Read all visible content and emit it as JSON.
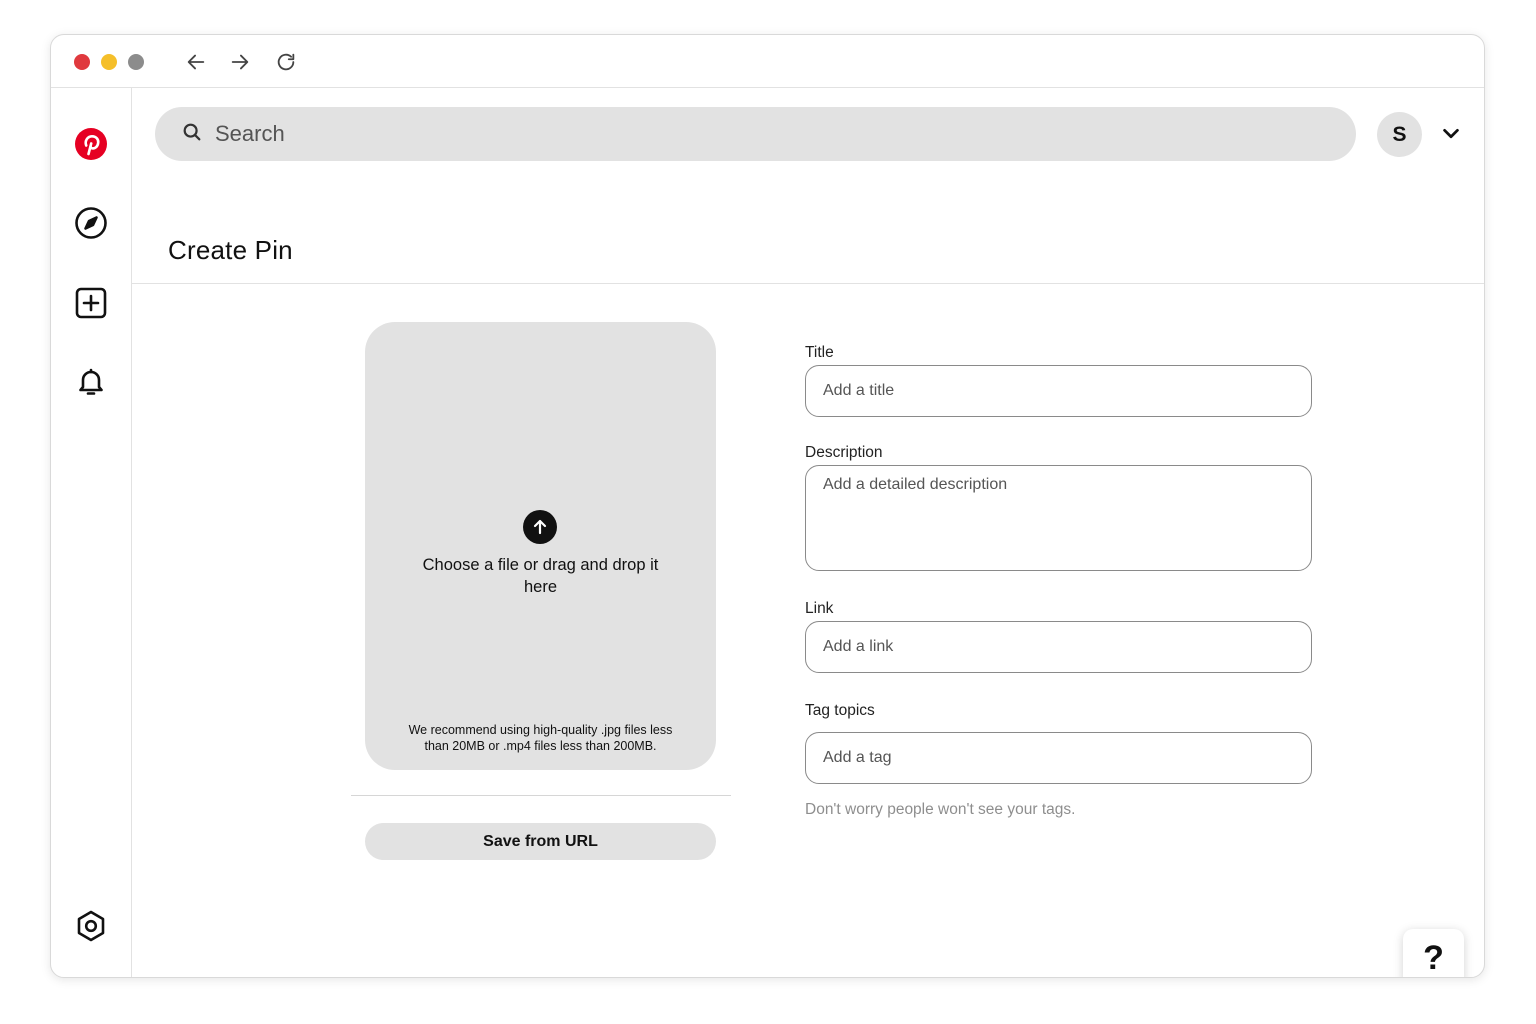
{
  "browser": {
    "controls": [
      "close",
      "minimize",
      "maximize"
    ],
    "nav_icons": [
      "back-arrow-icon",
      "forward-arrow-icon",
      "reload-icon"
    ]
  },
  "sidebar": {
    "items": [
      {
        "name": "pinterest-logo-icon",
        "color": "#e60023"
      },
      {
        "name": "explore-compass-icon"
      },
      {
        "name": "create-plus-icon"
      },
      {
        "name": "notifications-bell-icon"
      },
      {
        "name": "settings-hexagon-icon"
      }
    ]
  },
  "header": {
    "search_placeholder": "Search",
    "avatar_initial": "S"
  },
  "page": {
    "title": "Create Pin"
  },
  "upload": {
    "prompt": "Choose a file or drag and drop it here",
    "note": "We recommend using high-quality .jpg files less than 20MB or .mp4 files less than 200MB.",
    "save_from_url": "Save from URL"
  },
  "form": {
    "title_label": "Title",
    "title_placeholder": "Add a title",
    "description_label": "Description",
    "description_placeholder": "Add a detailed description",
    "link_label": "Link",
    "link_placeholder": "Add a link",
    "tags_label": "Tag topics",
    "tags_placeholder": "Add a tag",
    "tags_hint": "Don't worry people won't see your tags."
  },
  "help": {
    "label": "?"
  },
  "colors": {
    "accent": "#e60023",
    "surface": "#e2e2e2"
  }
}
